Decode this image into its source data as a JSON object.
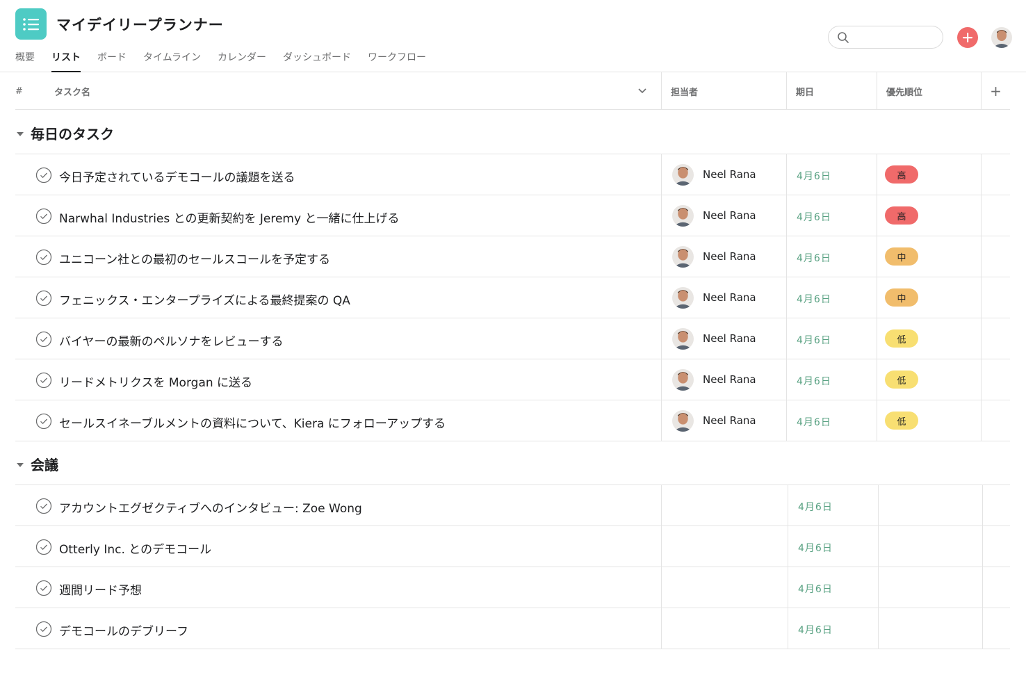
{
  "app": {
    "title": "マイデイリープランナー",
    "icon": "list-icon",
    "accent_color": "#4ecbc4"
  },
  "tabs": [
    {
      "label": "概要",
      "active": false
    },
    {
      "label": "リスト",
      "active": true
    },
    {
      "label": "ボード",
      "active": false
    },
    {
      "label": "タイムライン",
      "active": false
    },
    {
      "label": "カレンダー",
      "active": false
    },
    {
      "label": "ダッシュボード",
      "active": false
    },
    {
      "label": "ワークフロー",
      "active": false
    }
  ],
  "search": {
    "value": "",
    "placeholder": ""
  },
  "columns": {
    "num": "#",
    "name": "タスク名",
    "assignee": "担当者",
    "due": "期日",
    "priority": "優先順位",
    "add": "+"
  },
  "priority_colors": {
    "高": {
      "bg": "#f06a6a",
      "fg": "#1e1f21"
    },
    "中": {
      "bg": "#f1bd6c",
      "fg": "#1e1f21"
    },
    "低": {
      "bg": "#f8df72",
      "fg": "#1e1f21"
    }
  },
  "sections": [
    {
      "title": "毎日のタスク",
      "tasks": [
        {
          "name": "今日予定されているデモコールの議題を送る",
          "assignee": "Neel Rana",
          "due": "4月6日",
          "priority": "高"
        },
        {
          "name": "Narwhal Industries との更新契約を Jeremy と一緒に仕上げる",
          "assignee": "Neel Rana",
          "due": "4月6日",
          "priority": "高"
        },
        {
          "name": "ユニコーン社との最初のセールスコールを予定する",
          "assignee": "Neel Rana",
          "due": "4月6日",
          "priority": "中"
        },
        {
          "name": "フェニックス・エンタープライズによる最終提案の QA",
          "assignee": "Neel Rana",
          "due": "4月6日",
          "priority": "中"
        },
        {
          "name": "バイヤーの最新のペルソナをレビューする",
          "assignee": "Neel Rana",
          "due": "4月6日",
          "priority": "低"
        },
        {
          "name": "リードメトリクスを Morgan に送る",
          "assignee": "Neel Rana",
          "due": "4月6日",
          "priority": "低"
        },
        {
          "name": "セールスイネーブルメントの資料について、Kiera にフォローアップする",
          "assignee": "Neel Rana",
          "due": "4月6日",
          "priority": "低"
        }
      ]
    },
    {
      "title": "会議",
      "tasks": [
        {
          "name": "アカウントエグゼクティブへのインタビュー: Zoe Wong",
          "assignee": "",
          "due": "4月6日",
          "priority": ""
        },
        {
          "name": "Otterly Inc. とのデモコール",
          "assignee": "",
          "due": "4月6日",
          "priority": ""
        },
        {
          "name": "週間リード予想",
          "assignee": "",
          "due": "4月6日",
          "priority": ""
        },
        {
          "name": "デモコールのデブリーフ",
          "assignee": "",
          "due": "4月6日",
          "priority": ""
        }
      ]
    }
  ]
}
